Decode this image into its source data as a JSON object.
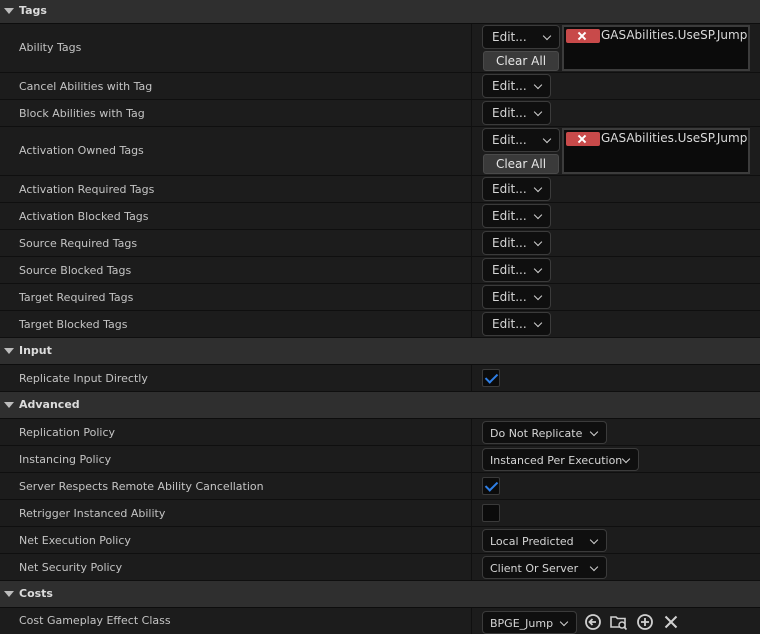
{
  "sections": {
    "tags": "Tags",
    "input": "Input",
    "advanced": "Advanced",
    "costs": "Costs"
  },
  "tags": {
    "ability_tags": "Ability Tags",
    "cancel_abilities": "Cancel Abilities with Tag",
    "block_abilities": "Block Abilities with Tag",
    "activation_owned": "Activation Owned Tags",
    "activation_required": "Activation Required Tags",
    "activation_blocked": "Activation Blocked Tags",
    "source_required": "Source Required Tags",
    "source_blocked": "Source Blocked Tags",
    "target_required": "Target Required Tags",
    "target_blocked": "Target Blocked Tags",
    "edit_label": "Edit...",
    "clear_all_label": "Clear All",
    "tag_value": "GASAbilities.UseSP.Jump"
  },
  "input": {
    "replicate_input_directly": "Replicate Input Directly",
    "replicate_input_checked": true
  },
  "advanced": {
    "replication_policy_label": "Replication Policy",
    "replication_policy_value": "Do Not Replicate",
    "instancing_policy_label": "Instancing Policy",
    "instancing_policy_value": "Instanced Per Execution",
    "server_respects_label": "Server Respects Remote Ability Cancellation",
    "server_respects_checked": true,
    "retrigger_label": "Retrigger Instanced Ability",
    "retrigger_checked": false,
    "net_execution_label": "Net Execution Policy",
    "net_execution_value": "Local Predicted",
    "net_security_label": "Net Security Policy",
    "net_security_value": "Client Or Server"
  },
  "costs": {
    "cost_ge_class_label": "Cost Gameplay Effect Class",
    "cost_ge_class_value": "BPGE_Jump"
  },
  "colors": {
    "checkbox_tick": "#2f7fe6",
    "tag_remove": "#c84a4a"
  }
}
